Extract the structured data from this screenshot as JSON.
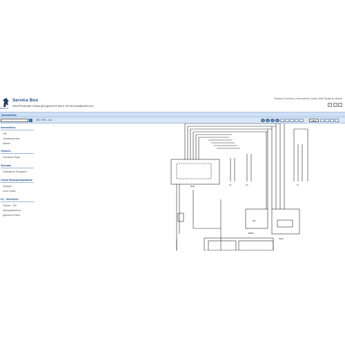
{
  "header": {
    "logo_text": "PEUGEOT",
    "brand": "Service Box",
    "subtitle": "ЭЛЕКТРИЧЕСКИЕ СХЕМЫ ДЛЯ ДИАГНОСТИКИ И ТЕХОБСЛУЖИВАНИЯ 2013",
    "top_links": "Помощь  |  Контакты  |  Исполнение Схемы  |  Мой Профиль  |  Выйти"
  },
  "section": {
    "label": "Автомобиль"
  },
  "toolbar": {
    "search_value": "",
    "path": "208  /  EPB  -  1111",
    "zoom": "100%"
  },
  "sidebar": [
    {
      "category": "Автомобиль",
      "items": [
        "208",
        "Характеристики",
        "Кабель"
      ]
    },
    {
      "category": "Область",
      "items": [
        "Основной Экран"
      ]
    },
    {
      "category": "Функция",
      "items": [
        "Освещение Переднего"
      ]
    },
    {
      "category": "Схема Функционирования",
      "items": [
        "Функция",
        "Блок-Схема"
      ]
    },
    {
      "category": "PC - 06/10/2013",
      "items": [
        "Сборка - 103",
        "Принадлежности",
        "Двигатель Работ"
      ]
    }
  ],
  "diagram": {
    "component_labels": [
      "BSI1",
      "0004",
      "BB00"
    ],
    "connector_labels": [
      "V1",
      "V2",
      "M",
      "MC"
    ],
    "line_color": "#222222"
  }
}
